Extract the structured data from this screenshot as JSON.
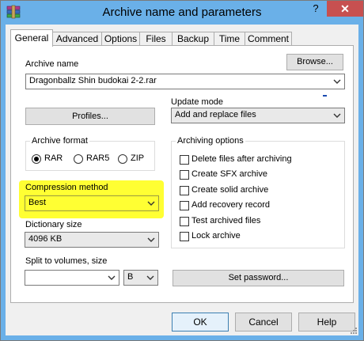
{
  "window": {
    "title": "Archive name and parameters",
    "help_glyph": "?",
    "close_glyph": "✕"
  },
  "tabs": [
    {
      "label": "General"
    },
    {
      "label": "Advanced"
    },
    {
      "label": "Options"
    },
    {
      "label": "Files"
    },
    {
      "label": "Backup"
    },
    {
      "label": "Time"
    },
    {
      "label": "Comment"
    }
  ],
  "archive_name": {
    "label": "Archive name",
    "browse_label": "Browse...",
    "value": "Dragonballz Shin budokai 2-2.rar"
  },
  "update_mode": {
    "label": "Update mode",
    "value": "Add and replace files"
  },
  "profiles_label": "Profiles...",
  "archive_format": {
    "title": "Archive format",
    "options": [
      "RAR",
      "RAR5",
      "ZIP"
    ],
    "selected": "RAR"
  },
  "compression": {
    "label": "Compression method",
    "value": "Best"
  },
  "dictionary": {
    "label": "Dictionary size",
    "value": "4096 KB"
  },
  "split": {
    "label": "Split to volumes, size",
    "value": "",
    "unit": "B"
  },
  "archiving_options": {
    "title": "Archiving options",
    "items": [
      {
        "label": "Delete files after archiving",
        "checked": false
      },
      {
        "label": "Create SFX archive",
        "checked": false
      },
      {
        "label": "Create solid archive",
        "checked": false
      },
      {
        "label": "Add recovery record",
        "checked": false
      },
      {
        "label": "Test archived files",
        "checked": false
      },
      {
        "label": "Lock archive",
        "checked": false
      }
    ]
  },
  "set_password_label": "Set password...",
  "buttons": {
    "ok": "OK",
    "cancel": "Cancel",
    "help": "Help"
  },
  "colors": {
    "titlebar": "#6ab0e8",
    "close": "#c75050",
    "highlight": "#ffff33"
  },
  "icons": {
    "app": "winrar-books-icon",
    "dropdown": "chevron-down-icon"
  }
}
